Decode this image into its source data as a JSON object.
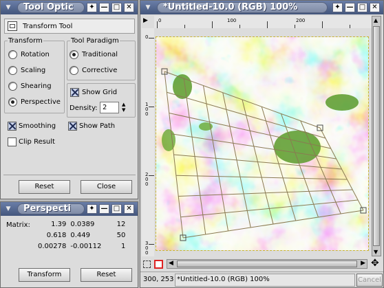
{
  "tool_window": {
    "title": "Tool Optic",
    "header_title": "Transform Tool",
    "transform_group": {
      "label": "Transform",
      "options": [
        {
          "label": "Rotation",
          "selected": false
        },
        {
          "label": "Scaling",
          "selected": false
        },
        {
          "label": "Shearing",
          "selected": false
        },
        {
          "label": "Perspective",
          "selected": true
        }
      ]
    },
    "paradigm_group": {
      "label": "Tool Paradigm",
      "options": [
        {
          "label": "Traditional",
          "selected": true
        },
        {
          "label": "Corrective",
          "selected": false
        }
      ]
    },
    "show_grid_label": "Show Grid",
    "show_grid_checked": true,
    "density_label": "Density:",
    "density_value": "2",
    "smoothing_label": "Smoothing",
    "smoothing_checked": true,
    "show_path_label": "Show Path",
    "show_path_checked": true,
    "clip_result_label": "Clip Result",
    "clip_result_checked": false,
    "reset_label": "Reset",
    "close_label": "Close"
  },
  "perspective_window": {
    "title": "Perspecti",
    "matrix_label": "Matrix:",
    "matrix": [
      [
        "1.39",
        "0.0389",
        "12"
      ],
      [
        "0.618",
        "0.449",
        "50"
      ],
      [
        "0.00278",
        "-0.00112",
        "1"
      ]
    ],
    "transform_label": "Transform",
    "reset_label": "Reset"
  },
  "image_window": {
    "title": "*Untitled-10.0 (RGB) 100%",
    "ruler_top": [
      "0",
      "100",
      "200"
    ],
    "ruler_left": [
      "0",
      "1\n0\n0",
      "2\n0\n0",
      "3\n0\n0"
    ],
    "coords": "300, 253",
    "status": "*Untitled-10.0 (RGB) 100%",
    "cancel_label": "Cancel"
  },
  "colors": {
    "titlebar": "#55688f",
    "panel_bg": "#dcdcdc",
    "grid_line": "#8a7a52",
    "cloud_blue": "#3f5dbb",
    "cloud_green": "#5a9a2a"
  }
}
